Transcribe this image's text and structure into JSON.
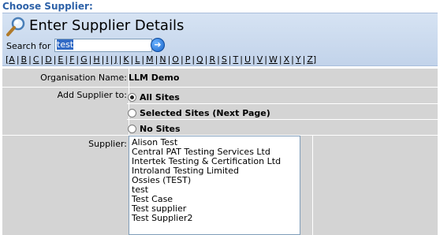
{
  "heading": "Choose Supplier:",
  "panel": {
    "title": "Enter Supplier Details",
    "search_label": "Search for",
    "search_value": "test",
    "go_icon": "arrow-right-circle-icon",
    "alphabet": [
      "A",
      "B",
      "C",
      "D",
      "E",
      "F",
      "G",
      "H",
      "I",
      "J",
      "K",
      "L",
      "M",
      "N",
      "O",
      "P",
      "Q",
      "R",
      "S",
      "T",
      "U",
      "V",
      "W",
      "X",
      "Y",
      "Z"
    ]
  },
  "form": {
    "org_label": "Organisation Name:",
    "org_value": "LLM Demo",
    "add_label": "Add Supplier to:",
    "options": [
      {
        "label": "All Sites",
        "checked": true
      },
      {
        "label": "Selected Sites (Next Page)",
        "checked": false
      },
      {
        "label": "No Sites",
        "checked": false
      }
    ],
    "supplier_label": "Supplier:",
    "suppliers": [
      "Alison Test",
      "Central PAT Testing Services Ltd",
      "Intertek Testing & Certification Ltd",
      "Introland Testing Limited",
      "Ossies (TEST)",
      "test",
      "Test Case",
      "Test supplier",
      "Test Supplier2"
    ]
  }
}
